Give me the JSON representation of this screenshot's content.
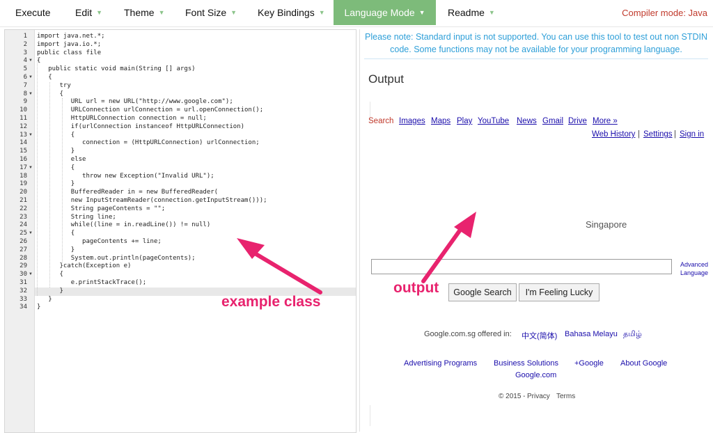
{
  "toolbar": {
    "items": [
      {
        "label": "Execute",
        "dropdown": false
      },
      {
        "label": "Edit",
        "dropdown": true
      },
      {
        "label": "Theme",
        "dropdown": true
      },
      {
        "label": "Font Size",
        "dropdown": true
      },
      {
        "label": "Key Bindings",
        "dropdown": true
      },
      {
        "label": "Language Mode",
        "dropdown": true,
        "active": true
      },
      {
        "label": "Readme",
        "dropdown": true
      }
    ],
    "compiler_mode": "Compiler mode: Java"
  },
  "editor": {
    "line_numbers": [
      "1",
      "2",
      "3",
      "4",
      "5",
      "6",
      "7",
      "8",
      "9",
      "10",
      "11",
      "12",
      "13",
      "14",
      "15",
      "16",
      "17",
      "18",
      "19",
      "20",
      "21",
      "22",
      "23",
      "24",
      "25",
      "26",
      "27",
      "28",
      "29",
      "30",
      "31",
      "32",
      "33",
      "34"
    ],
    "active_line": "32",
    "lines": [
      "import java.net.*;",
      "import java.io.*;",
      "public class file",
      "{",
      "   public static void main(String [] args)",
      "   {",
      "      try",
      "      {",
      "         URL url = new URL(\"http://www.google.com\");",
      "         URLConnection urlConnection = url.openConnection();",
      "         HttpURLConnection connection = null;",
      "         if(urlConnection instanceof HttpURLConnection)",
      "         {",
      "            connection = (HttpURLConnection) urlConnection;",
      "         }",
      "         else",
      "         {",
      "            throw new Exception(\"Invalid URL\");",
      "         }",
      "         BufferedReader in = new BufferedReader(",
      "         new InputStreamReader(connection.getInputStream()));",
      "         String pageContents = \"\";",
      "         String line;",
      "         while((line = in.readLine()) != null)",
      "         {",
      "            pageContents += line;",
      "         }",
      "         System.out.println(pageContents);",
      "      }catch(Exception e)",
      "      {",
      "         e.printStackTrace();",
      "      }",
      "   }",
      "}"
    ]
  },
  "output_panel": {
    "notice": "Please note: Standard input is not supported. You can use this tool to test out non STDIN code. Some functions may not be available for your programming language.",
    "title": "Output",
    "google_nav": [
      "Search",
      "Images",
      "Maps",
      "Play",
      "YouTube",
      "News",
      "Gmail",
      "Drive",
      "More »"
    ],
    "google_right": [
      "Web History",
      "Settings",
      "Sign in"
    ],
    "location": "Singapore",
    "advanced": "Advanced",
    "language": "Language",
    "buttons": [
      "Google Search",
      "I'm Feeling Lucky"
    ],
    "offered_prefix": "Google.com.sg offered in:",
    "offered_languages": [
      "中文(简体)",
      "Bahasa Melayu",
      "தமிழ்"
    ],
    "footer_links": [
      "Advertising Programs",
      "Business Solutions",
      "+Google",
      "About Google"
    ],
    "footer_domain": "Google.com",
    "copyright": "© 2015 -",
    "privacy": "Privacy",
    "terms": "Terms"
  },
  "annotations": {
    "example_class": "example class",
    "output": "output",
    "color": "#e8236e"
  }
}
